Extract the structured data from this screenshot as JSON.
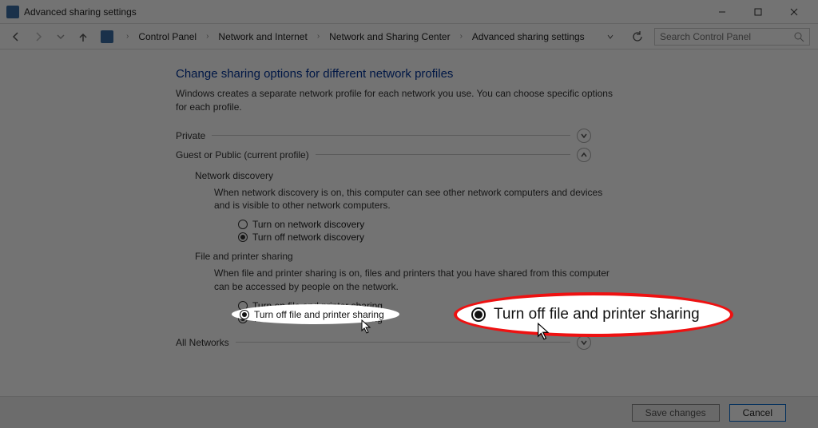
{
  "window": {
    "title": "Advanced sharing settings"
  },
  "breadcrumb": {
    "items": [
      "Control Panel",
      "Network and Internet",
      "Network and Sharing Center",
      "Advanced sharing settings"
    ]
  },
  "search": {
    "placeholder": "Search Control Panel"
  },
  "page": {
    "title": "Change sharing options for different network profiles",
    "desc": "Windows creates a separate network profile for each network you use. You can choose specific options for each profile."
  },
  "sections": {
    "private": {
      "label": "Private"
    },
    "guest": {
      "label": "Guest or Public (current profile)",
      "discovery": {
        "title": "Network discovery",
        "desc": "When network discovery is on, this computer can see other network computers and devices and is visible to other network computers.",
        "opt_on": "Turn on network discovery",
        "opt_off": "Turn off network discovery",
        "selected": "off"
      },
      "sharing": {
        "title": "File and printer sharing",
        "desc": "When file and printer sharing is on, files and printers that you have shared from this computer can be accessed by people on the network.",
        "opt_on": "Turn on file and printer sharing",
        "opt_off": "Turn off file and printer sharing",
        "selected": "off"
      }
    },
    "all": {
      "label": "All Networks"
    }
  },
  "callout": {
    "label": "Turn off file and printer sharing"
  },
  "footer": {
    "save": "Save changes",
    "cancel": "Cancel"
  }
}
